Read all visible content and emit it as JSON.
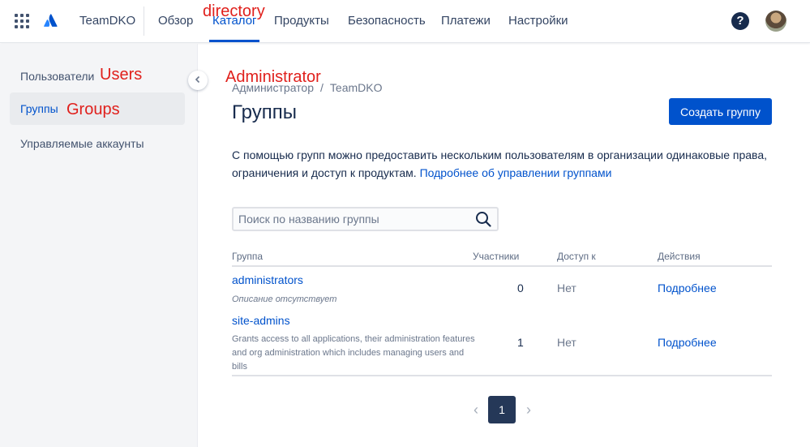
{
  "topnav": {
    "site_name": "TeamDKO",
    "items": [
      {
        "label": "Обзор"
      },
      {
        "label": "Каталог"
      },
      {
        "label": "Продукты"
      },
      {
        "label": "Безопасность"
      },
      {
        "label": "Платежи"
      },
      {
        "label": "Настройки"
      }
    ],
    "active_item": "Каталог",
    "help_icon": "question-icon",
    "help_glyph": "?"
  },
  "annotations": {
    "directory": "directory",
    "administrator": "Administrator",
    "users": "Users",
    "groups": "Groups"
  },
  "sidebar": {
    "items": [
      {
        "label": "Пользователи"
      },
      {
        "label": "Группы"
      },
      {
        "label": "Управляемые аккаунты"
      }
    ],
    "active_item": "Группы"
  },
  "breadcrumb": {
    "items": [
      "Администратор",
      "TeamDKO"
    ],
    "separator": "/"
  },
  "page": {
    "title": "Группы",
    "create_button": "Создать группу",
    "description_text": "С помощью групп можно предоставить нескольким пользователям в организации одинаковые права, ограничения и доступ к продуктам.",
    "description_link": "Подробнее об управлении группами"
  },
  "search": {
    "placeholder": "Поиск по названию группы",
    "value": ""
  },
  "table": {
    "columns": [
      "Группа",
      "Участники",
      "Доступ к",
      "Действия"
    ],
    "rows": [
      {
        "name": "administrators",
        "description": "Описание отсутствует",
        "members": "0",
        "access": "Нет",
        "action": "Подробнее"
      },
      {
        "name": "site-admins",
        "description": "Grants access to all applications, their administration features and org administration which includes managing users and bills",
        "members": "1",
        "access": "Нет",
        "action": "Подробнее"
      }
    ]
  },
  "pagination": {
    "current": "1",
    "prev_glyph": "‹",
    "next_glyph": "›"
  },
  "colors": {
    "accent": "#0052cc",
    "annotation": "#e0201c",
    "pagination_active": "#253858"
  }
}
